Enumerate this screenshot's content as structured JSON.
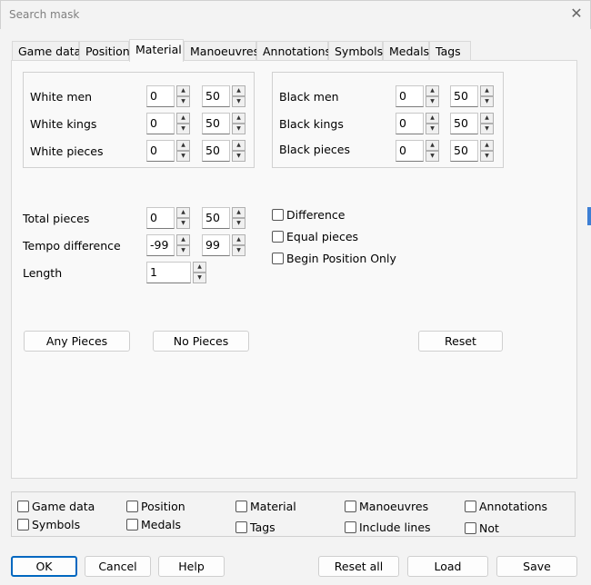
{
  "window": {
    "title": "Search mask"
  },
  "tabs": [
    {
      "label": "Game data"
    },
    {
      "label": "Position"
    },
    {
      "label": "Material"
    },
    {
      "label": "Manoeuvres"
    },
    {
      "label": "Annotations"
    },
    {
      "label": "Symbols"
    },
    {
      "label": "Medals"
    },
    {
      "label": "Tags"
    }
  ],
  "active_tab": "Material",
  "white": {
    "men": {
      "label": "White men",
      "min": "0",
      "max": "50"
    },
    "kings": {
      "label": "White kings",
      "min": "0",
      "max": "50"
    },
    "pieces": {
      "label": "White pieces",
      "min": "0",
      "max": "50"
    }
  },
  "black": {
    "men": {
      "label": "Black men",
      "min": "0",
      "max": "50"
    },
    "kings": {
      "label": "Black kings",
      "min": "0",
      "max": "50"
    },
    "pieces": {
      "label": "Black pieces",
      "min": "0",
      "max": "50"
    }
  },
  "totals": {
    "total": {
      "label": "Total pieces",
      "min": "0",
      "max": "50"
    },
    "tempo": {
      "label": "Tempo difference",
      "min": "-99",
      "max": "99"
    },
    "length": {
      "label": "Length",
      "value": "1"
    }
  },
  "options": {
    "difference": "Difference",
    "equal": "Equal pieces",
    "begin": "Begin Position Only"
  },
  "buttons": {
    "any": "Any Pieces",
    "none": "No Pieces",
    "reset": "Reset",
    "ok": "OK",
    "cancel": "Cancel",
    "help": "Help",
    "reset_all": "Reset all",
    "load": "Load",
    "save": "Save"
  },
  "filters": {
    "game_data": "Game data",
    "position": "Position",
    "material": "Material",
    "manoeuvres": "Manoeuvres",
    "annotations": "Annotations",
    "symbols": "Symbols",
    "medals": "Medals",
    "tags": "Tags",
    "include_lines": "Include lines",
    "not": "Not"
  },
  "icons": {
    "close": "close-icon",
    "spin_up": "chevron-up-icon",
    "spin_down": "chevron-down-icon"
  }
}
